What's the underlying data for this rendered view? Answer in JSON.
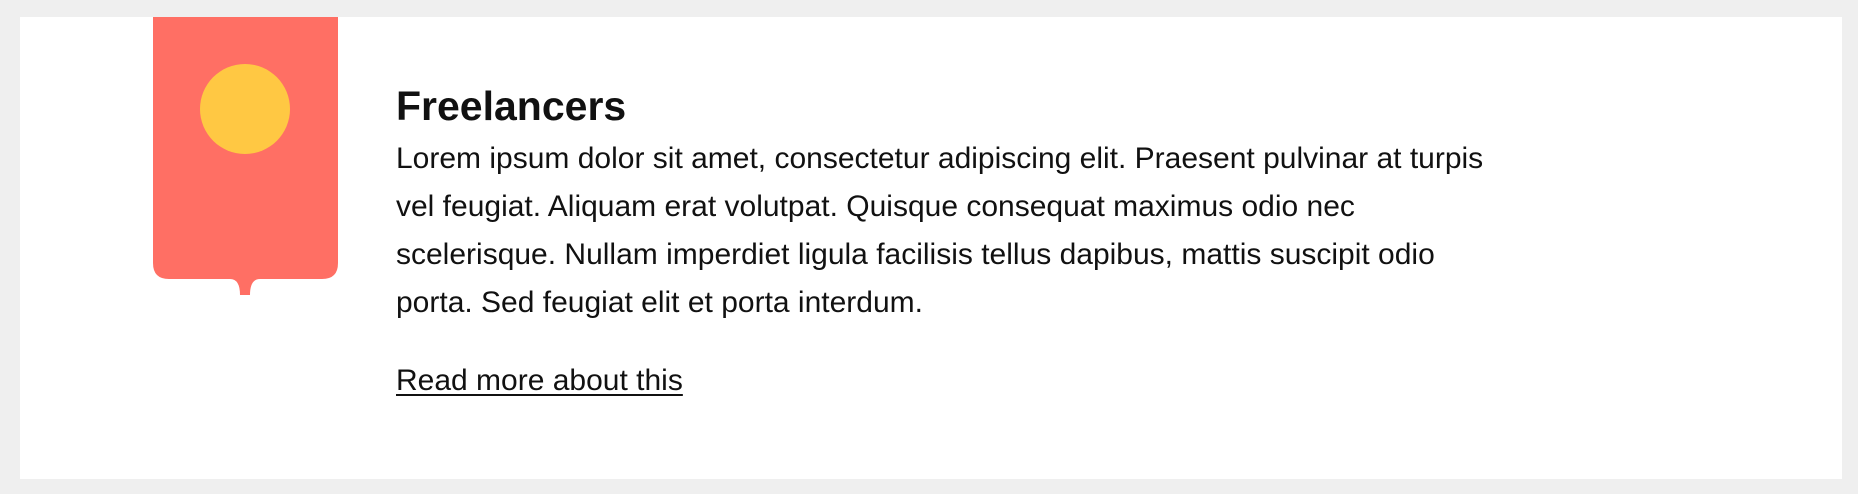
{
  "card": {
    "title": "Freelancers",
    "description": "Lorem ipsum dolor sit amet, consectetur adipiscing elit. Praesent pulvinar at turpis vel feugiat. Aliquam erat volutpat. Quisque consequat maximus odio nec scelerisque. Nullam imperdiet ligula facilisis tellus dapibus, mattis suscipit odio porta. Sed feugiat elit et porta interdum.",
    "link_label": "Read more about this"
  },
  "colors": {
    "page_background": "#efefef",
    "card_background": "#ffffff",
    "banner": "#ff6f64",
    "banner_circle": "#ffc843",
    "text": "#111111"
  },
  "icons": {
    "banner": "bookmark-banner-icon",
    "circle": "yellow-circle-icon"
  }
}
